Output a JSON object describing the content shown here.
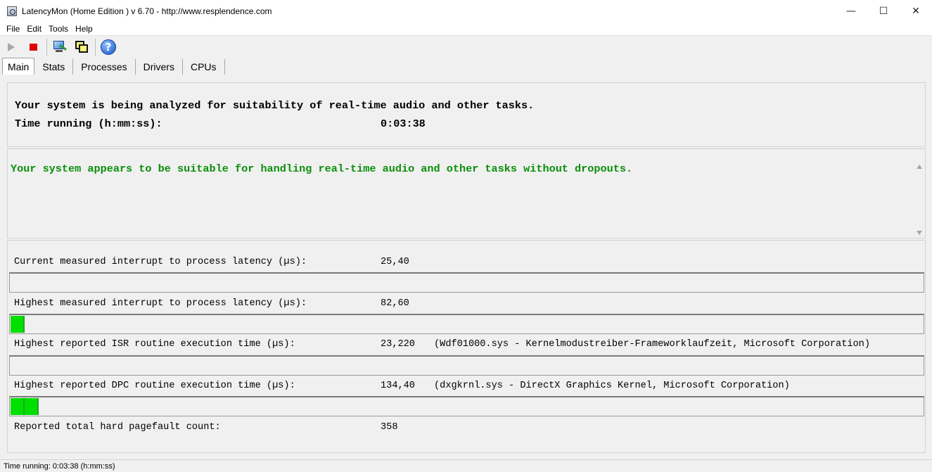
{
  "window": {
    "title": "LatencyMon  (Home Edition )  v 6.70 - http://www.resplendence.com",
    "controls": {
      "minimize": "—",
      "maximize": "☐",
      "close": "✕"
    }
  },
  "menu": [
    "File",
    "Edit",
    "Tools",
    "Help"
  ],
  "toolbar": {
    "icons": [
      "play-icon",
      "stop-icon",
      "monitor-wand-icon",
      "windows-icon",
      "help-icon"
    ],
    "help_glyph": "?"
  },
  "tabs": [
    {
      "label": "Main",
      "active": true
    },
    {
      "label": "Stats",
      "active": false
    },
    {
      "label": "Processes",
      "active": false
    },
    {
      "label": "Drivers",
      "active": false
    },
    {
      "label": "CPUs",
      "active": false
    }
  ],
  "status": {
    "headline": "Your system is being analyzed for suitability of real-time audio and other tasks.",
    "time_label": "Time running (h:mm:ss):",
    "time_value": "0:03:38"
  },
  "verdict": {
    "text": "Your system appears to be suitable for handling real-time audio and other tasks without dropouts.",
    "color": "#0a8f0a"
  },
  "metrics": [
    {
      "label": "Current measured interrupt to process latency (µs):",
      "value": "25,40",
      "driver": "",
      "bar_segments": 0
    },
    {
      "label": "Highest measured interrupt to process latency (µs):",
      "value": "82,60",
      "driver": "",
      "bar_segments": 1
    },
    {
      "label": "Highest reported ISR routine execution time (µs):",
      "value": "23,220",
      "driver": "(Wdf01000.sys - Kernelmodustreiber-Frameworklaufzeit, Microsoft Corporation)",
      "bar_segments": 0
    },
    {
      "label": "Highest reported DPC routine execution time (µs):",
      "value": "134,40",
      "driver": "(dxgkrnl.sys - DirectX Graphics Kernel, Microsoft Corporation)",
      "bar_segments": 2
    }
  ],
  "pagefault": {
    "label": "Reported total hard pagefault count:",
    "value": "358"
  },
  "statusbar": {
    "text": "Time running: 0:03:38  (h:mm:ss)"
  },
  "colors": {
    "bar_fill": "#00e000",
    "stop": "#e00000",
    "accent_text": "#0a8f0a"
  }
}
